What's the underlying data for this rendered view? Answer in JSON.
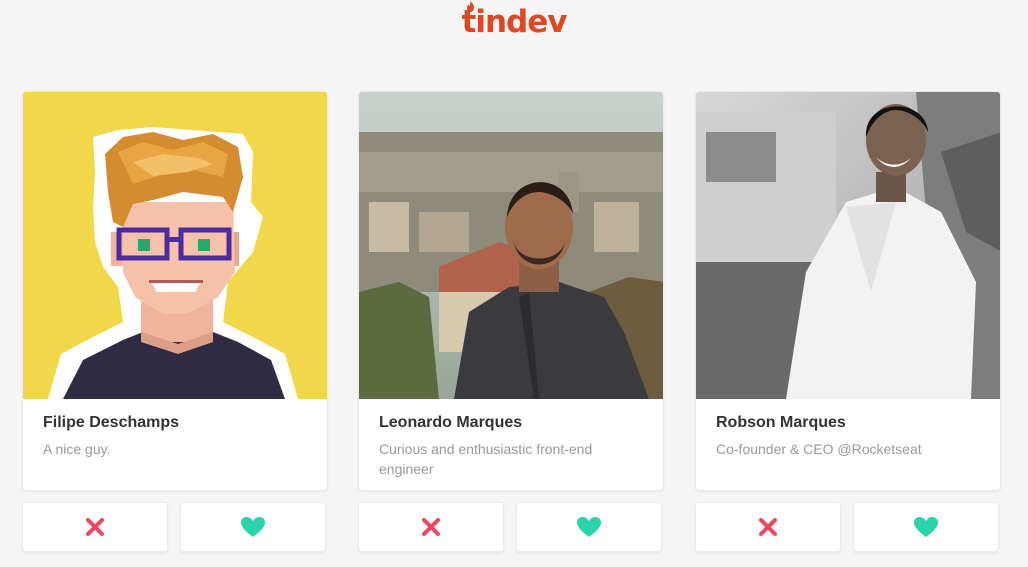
{
  "app": {
    "logo_text": "tindev"
  },
  "colors": {
    "brand": "#df4723",
    "dislike": "#f5455c",
    "like": "#2bd4a8",
    "background": "#f5f5f5"
  },
  "users": [
    {
      "name": "Filipe Deschamps",
      "bio": "A nice guy.",
      "avatar": "pixel-art-avatar"
    },
    {
      "name": "Leonardo Marques",
      "bio": "Curious and enthusiastic front-end engineer",
      "avatar": "photo-city-view"
    },
    {
      "name": "Robson Marques",
      "bio": "Co-founder & CEO @Rocketseat",
      "avatar": "photo-black-and-white"
    }
  ],
  "icons": {
    "dislike": "close-icon",
    "like": "heart-icon"
  }
}
